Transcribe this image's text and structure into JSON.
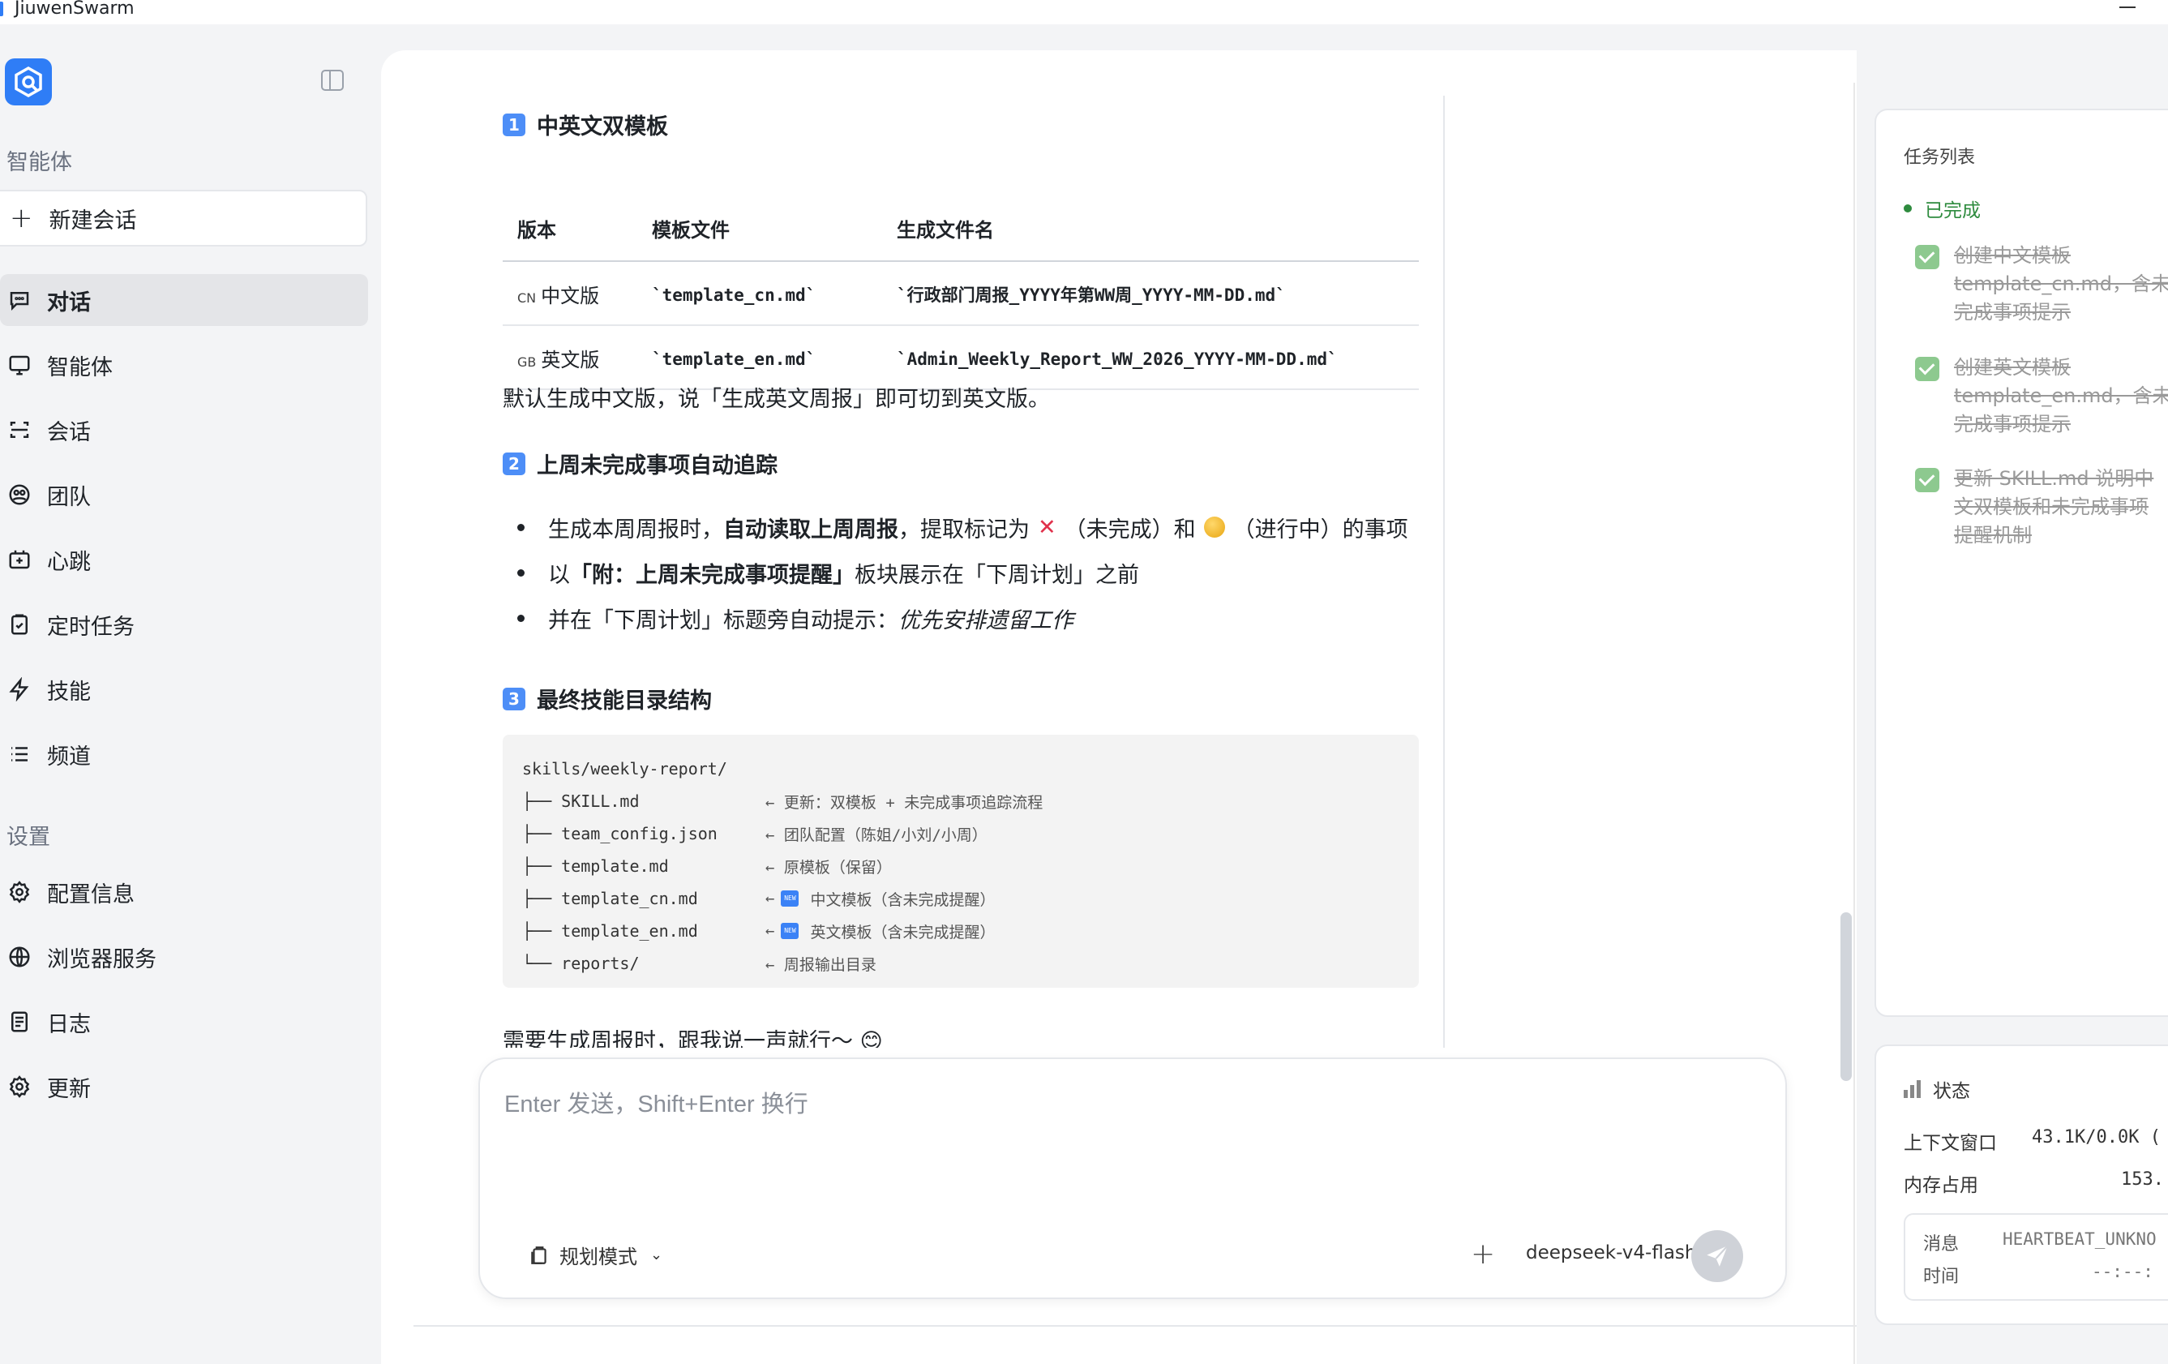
{
  "app": {
    "title": "JiuwenSwarm"
  },
  "sidebar": {
    "section_agents": "智能体",
    "new_chat": "新建会话",
    "items": [
      {
        "label": "对话",
        "icon": "chat-icon"
      },
      {
        "label": "智能体",
        "icon": "monitor-icon"
      },
      {
        "label": "会话",
        "icon": "session-icon"
      },
      {
        "label": "团队",
        "icon": "team-icon"
      },
      {
        "label": "心跳",
        "icon": "heartbeat-icon"
      },
      {
        "label": "定时任务",
        "icon": "clipboard-icon"
      },
      {
        "label": "技能",
        "icon": "bolt-icon"
      },
      {
        "label": "频道",
        "icon": "list-icon"
      }
    ],
    "section_settings": "设置",
    "settings": [
      {
        "label": "配置信息",
        "icon": "gear-icon"
      },
      {
        "label": "浏览器服务",
        "icon": "globe-icon"
      },
      {
        "label": "日志",
        "icon": "log-icon"
      },
      {
        "label": "更新",
        "icon": "gear-icon"
      }
    ]
  },
  "message": {
    "s1_num": "1",
    "s1_title": "中英文双模板",
    "table": {
      "headers": [
        "版本",
        "模板文件",
        "生成文件名"
      ],
      "rows": [
        {
          "flag": "CN",
          "version": "中文版",
          "template": "`template_cn.md`",
          "output": "`行政部门周报_YYYY年第WW周_YYYY-MM-DD.md`"
        },
        {
          "flag": "GB",
          "version": "英文版",
          "template": "`template_en.md`",
          "output": "`Admin_Weekly_Report_WW_2026_YYYY-MM-DD.md`"
        }
      ]
    },
    "default_note": "默认生成中文版，说「生成英文周报」即可切到英文版。",
    "s2_num": "2",
    "s2_title": "上周未完成事项自动追踪",
    "b1_pre": "生成本周周报时，",
    "b1_bold": "自动读取上周周报",
    "b1_mid": "，提取标记为",
    "b1_x": "✕",
    "b1_mid2": "（未完成）和",
    "b1_post": "（进行中）的事项",
    "b2_pre": "以 ",
    "b2_bold": "「附：上周未完成事项提醒」",
    "b2_post": " 板块展示在「下周计划」之前",
    "b3_pre": "并在「下周计划」标题旁自动提示：",
    "b3_italic": "优先安排遗留工作",
    "s3_num": "3",
    "s3_title": "最终技能目录结构",
    "code": {
      "root": "skills/weekly-report/",
      "lines": [
        {
          "path": "├── SKILL.md",
          "comment": "← 更新：双模板 + 未完成事项追踪流程",
          "new": false
        },
        {
          "path": "├── team_config.json",
          "comment": "← 团队配置（陈姐/小刘/小周）",
          "new": false
        },
        {
          "path": "├── template.md",
          "comment": "← 原模板（保留）",
          "new": false
        },
        {
          "path": "├── template_cn.md",
          "comment": "中文模板（含未完成提醒）",
          "new": true
        },
        {
          "path": "├── template_en.md",
          "comment": "英文模板（含未完成提醒）",
          "new": true
        },
        {
          "path": "└── reports/",
          "comment": "← 周报输出目录",
          "new": false
        }
      ],
      "arrow": "←",
      "new_badge": "NEW"
    },
    "closing": "需要生成周报时，跟我说一声就行～ 😊"
  },
  "composer": {
    "placeholder": "Enter 发送，Shift+Enter 换行",
    "mode": "规划模式",
    "model": "deepseek-v4-flash"
  },
  "tasks": {
    "title": "任务列表",
    "status": "已完成",
    "items": [
      "创建中文模板\ntemplate_cn.md，含未\n完成事项提示",
      "创建英文模板\ntemplate_en.md，含未\n完成事项提示",
      "更新 SKILL.md 说明中\n文双模板和未完成事项\n提醒机制"
    ]
  },
  "status": {
    "title": "状态",
    "context_label": "上下文窗口",
    "context_value": "43.1K/0.0K (",
    "memory_label": "内存占用",
    "memory_value": "153.",
    "msg_label": "消息",
    "msg_value": "HEARTBEAT_UNKNO",
    "time_label": "时间",
    "time_value": "--:--:"
  }
}
